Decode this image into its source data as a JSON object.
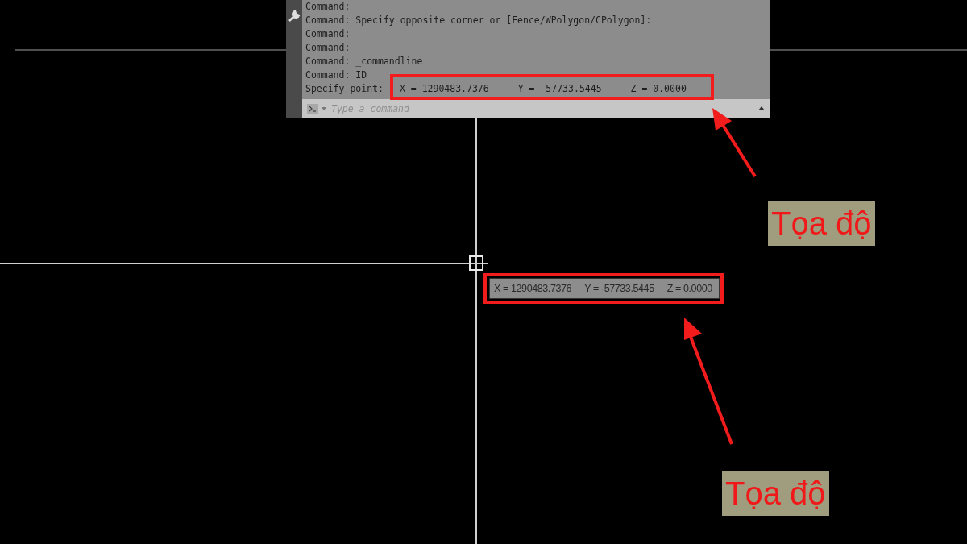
{
  "command_window": {
    "history": [
      "Command:",
      "Command: Specify opposite corner or [Fence/WPolygon/CPolygon]:",
      "Command:",
      "Command:",
      "Command: _commandline",
      "Command: ID"
    ],
    "last_line": {
      "prompt": "Specify point:",
      "coords": [
        "X = 1290483.7376",
        "Y = -57733.5445",
        "Z = 0.0000"
      ]
    },
    "input": {
      "placeholder": "Type a command"
    }
  },
  "tooltip": {
    "coords": [
      "X = 1290483.7376",
      "Y = -57733.5445",
      "Z = 0.0000"
    ]
  },
  "annotations": [
    {
      "label": "Tọa độ"
    },
    {
      "label": "Tọa độ"
    }
  ]
}
